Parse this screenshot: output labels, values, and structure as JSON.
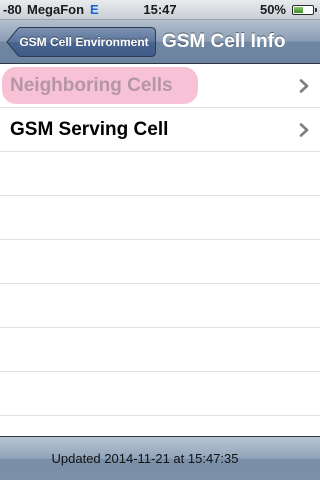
{
  "status_bar": {
    "signal": "-80",
    "carrier": "MegaFon",
    "network": "E",
    "time": "15:47",
    "battery": "50%",
    "battery_level": 0.5
  },
  "nav": {
    "back_label": "GSM Cell Environment",
    "title": "GSM Cell Info"
  },
  "rows": [
    {
      "label": "Neighboring Cells"
    },
    {
      "label": "GSM Serving Cell"
    }
  ],
  "toolbar": {
    "updated_text": "Updated 2014-11-21 at 15:47:35"
  },
  "colors": {
    "highlight": "#f7c1d6",
    "network_badge": "#1c63d6"
  }
}
